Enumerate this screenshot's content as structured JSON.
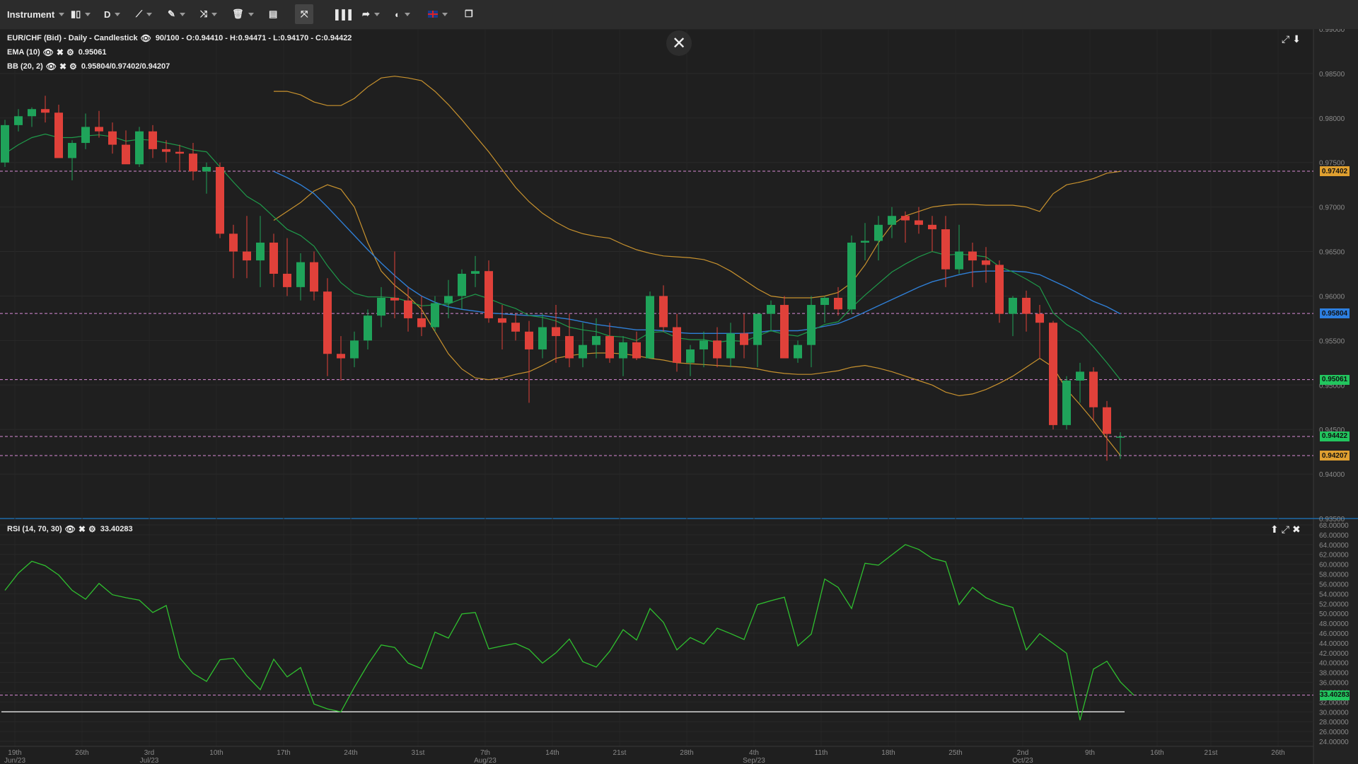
{
  "toolbar": {
    "instrument_label": "Instrument",
    "timeframe_label": "D",
    "icons": [
      "candlestick-icon",
      "line-draw-icon",
      "pencil-icon",
      "trend-icon",
      "trash-icon",
      "layout-icon",
      "fit-icon",
      "volume-icon",
      "share-icon",
      "theme-icon",
      "flag-uk-icon",
      "window-icon"
    ]
  },
  "main_panel": {
    "title": "EUR/CHF (Bid) - Daily - Candlestick",
    "ohlc": "90/100 - O:0.94410 - H:0.94471 - L:0.94170 - C:0.94422",
    "ema_label": "EMA (10)",
    "ema_value": "0.95061",
    "bb_label": "BB (20, 2)",
    "bb_value": "0.95804/0.97402/0.94207"
  },
  "rsi_panel": {
    "label": "RSI (14, 70, 30)",
    "value": "33.40283"
  },
  "price_axis": [
    "0.99000",
    "0.98500",
    "0.98000",
    "0.97500",
    "0.97000",
    "0.96500",
    "0.96000",
    "0.95500",
    "0.95000",
    "0.94500",
    "0.94000",
    "0.93500"
  ],
  "price_tags": [
    {
      "text": "0.97402",
      "price": 0.97402,
      "color": "#e0a030"
    },
    {
      "text": "0.95804",
      "price": 0.95804,
      "color": "#2d7fe0"
    },
    {
      "text": "0.95061",
      "price": 0.95061,
      "color": "#22c55e"
    },
    {
      "text": "0.94422",
      "price": 0.94422,
      "color": "#22c55e"
    },
    {
      "text": "0.94207",
      "price": 0.94207,
      "color": "#e0a030"
    }
  ],
  "rsi_axis": [
    "68.00000",
    "66.00000",
    "64.00000",
    "62.00000",
    "60.00000",
    "58.00000",
    "56.00000",
    "54.00000",
    "52.00000",
    "50.00000",
    "48.00000",
    "46.00000",
    "44.00000",
    "42.00000",
    "40.00000",
    "38.00000",
    "36.00000",
    "34.00000",
    "32.00000",
    "30.00000",
    "28.00000",
    "26.00000",
    "24.00000"
  ],
  "rsi_tag": {
    "text": "33.40283",
    "value": 33.40283,
    "color": "#22c55e"
  },
  "date_axis": [
    {
      "label": "19th",
      "sub": "Jun/23"
    },
    {
      "label": "26th",
      "sub": ""
    },
    {
      "label": "3rd",
      "sub": "Jul/23"
    },
    {
      "label": "10th",
      "sub": ""
    },
    {
      "label": "17th",
      "sub": ""
    },
    {
      "label": "24th",
      "sub": ""
    },
    {
      "label": "31st",
      "sub": ""
    },
    {
      "label": "7th",
      "sub": "Aug/23"
    },
    {
      "label": "14th",
      "sub": ""
    },
    {
      "label": "21st",
      "sub": ""
    },
    {
      "label": "28th",
      "sub": ""
    },
    {
      "label": "4th",
      "sub": "Sep/23"
    },
    {
      "label": "11th",
      "sub": ""
    },
    {
      "label": "18th",
      "sub": ""
    },
    {
      "label": "25th",
      "sub": ""
    },
    {
      "label": "2nd",
      "sub": "Oct/23"
    },
    {
      "label": "9th",
      "sub": ""
    },
    {
      "label": "16th",
      "sub": ""
    },
    {
      "label": "21st",
      "sub": ""
    },
    {
      "label": "26th",
      "sub": ""
    }
  ],
  "chart_data": {
    "type": "candlestick",
    "ohlc": [
      [
        0.975,
        0.9798,
        0.9745,
        0.9792
      ],
      [
        0.9792,
        0.981,
        0.9785,
        0.9802
      ],
      [
        0.9802,
        0.9812,
        0.979,
        0.981
      ],
      [
        0.981,
        0.9825,
        0.9795,
        0.9806
      ],
      [
        0.9806,
        0.9815,
        0.978,
        0.9755
      ],
      [
        0.9755,
        0.9775,
        0.973,
        0.9772
      ],
      [
        0.9772,
        0.9805,
        0.9765,
        0.979
      ],
      [
        0.979,
        0.9808,
        0.9778,
        0.9785
      ],
      [
        0.9785,
        0.9795,
        0.976,
        0.977
      ],
      [
        0.977,
        0.9786,
        0.975,
        0.9748
      ],
      [
        0.9748,
        0.979,
        0.9745,
        0.9785
      ],
      [
        0.9785,
        0.9792,
        0.9755,
        0.9765
      ],
      [
        0.9765,
        0.9775,
        0.975,
        0.9762
      ],
      [
        0.9762,
        0.977,
        0.974,
        0.976
      ],
      [
        0.976,
        0.9772,
        0.973,
        0.974
      ],
      [
        0.974,
        0.975,
        0.9715,
        0.9745
      ],
      [
        0.9745,
        0.975,
        0.9665,
        0.967
      ],
      [
        0.967,
        0.968,
        0.962,
        0.965
      ],
      [
        0.965,
        0.969,
        0.962,
        0.964
      ],
      [
        0.964,
        0.969,
        0.961,
        0.966
      ],
      [
        0.966,
        0.967,
        0.961,
        0.9625
      ],
      [
        0.9625,
        0.9665,
        0.96,
        0.961
      ],
      [
        0.961,
        0.9648,
        0.9595,
        0.9638
      ],
      [
        0.9638,
        0.965,
        0.9595,
        0.9605
      ],
      [
        0.9605,
        0.962,
        0.951,
        0.9535
      ],
      [
        0.9535,
        0.9555,
        0.9505,
        0.953
      ],
      [
        0.953,
        0.956,
        0.952,
        0.955
      ],
      [
        0.955,
        0.9585,
        0.954,
        0.9578
      ],
      [
        0.9578,
        0.961,
        0.9565,
        0.9598
      ],
      [
        0.9598,
        0.965,
        0.9575,
        0.9595
      ],
      [
        0.9595,
        0.961,
        0.956,
        0.9575
      ],
      [
        0.9575,
        0.96,
        0.9555,
        0.9565
      ],
      [
        0.9565,
        0.96,
        0.956,
        0.9592
      ],
      [
        0.9592,
        0.9618,
        0.9575,
        0.96
      ],
      [
        0.96,
        0.963,
        0.9585,
        0.9625
      ],
      [
        0.9625,
        0.9645,
        0.961,
        0.9628
      ],
      [
        0.9628,
        0.964,
        0.957,
        0.9575
      ],
      [
        0.9575,
        0.959,
        0.954,
        0.957
      ],
      [
        0.957,
        0.958,
        0.955,
        0.956
      ],
      [
        0.956,
        0.9572,
        0.948,
        0.954
      ],
      [
        0.954,
        0.958,
        0.953,
        0.9565
      ],
      [
        0.9565,
        0.959,
        0.9525,
        0.9555
      ],
      [
        0.9555,
        0.958,
        0.952,
        0.953
      ],
      [
        0.953,
        0.957,
        0.952,
        0.9545
      ],
      [
        0.9545,
        0.9575,
        0.953,
        0.9555
      ],
      [
        0.9555,
        0.957,
        0.9525,
        0.953
      ],
      [
        0.953,
        0.9555,
        0.951,
        0.9548
      ],
      [
        0.9548,
        0.956,
        0.9528,
        0.953
      ],
      [
        0.953,
        0.9605,
        0.953,
        0.96
      ],
      [
        0.96,
        0.9612,
        0.956,
        0.9565
      ],
      [
        0.9565,
        0.958,
        0.9515,
        0.9525
      ],
      [
        0.9525,
        0.9545,
        0.951,
        0.954
      ],
      [
        0.954,
        0.956,
        0.952,
        0.955
      ],
      [
        0.955,
        0.9565,
        0.952,
        0.953
      ],
      [
        0.953,
        0.957,
        0.952,
        0.9558
      ],
      [
        0.9558,
        0.958,
        0.953,
        0.9545
      ],
      [
        0.9545,
        0.957,
        0.952,
        0.958
      ],
      [
        0.958,
        0.9595,
        0.956,
        0.959
      ],
      [
        0.959,
        0.96,
        0.953,
        0.953
      ],
      [
        0.953,
        0.955,
        0.9525,
        0.9545
      ],
      [
        0.9545,
        0.96,
        0.952,
        0.959
      ],
      [
        0.959,
        0.96,
        0.957,
        0.9598
      ],
      [
        0.9598,
        0.961,
        0.9578,
        0.9585
      ],
      [
        0.9585,
        0.9668,
        0.958,
        0.966
      ],
      [
        0.966,
        0.9682,
        0.964,
        0.9662
      ],
      [
        0.9662,
        0.969,
        0.964,
        0.968
      ],
      [
        0.968,
        0.97,
        0.9665,
        0.969
      ],
      [
        0.969,
        0.9695,
        0.966,
        0.9685
      ],
      [
        0.9685,
        0.97,
        0.967,
        0.968
      ],
      [
        0.968,
        0.969,
        0.965,
        0.9675
      ],
      [
        0.9675,
        0.969,
        0.961,
        0.963
      ],
      [
        0.963,
        0.968,
        0.9625,
        0.965
      ],
      [
        0.965,
        0.966,
        0.961,
        0.964
      ],
      [
        0.964,
        0.9655,
        0.9615,
        0.9635
      ],
      [
        0.9635,
        0.964,
        0.957,
        0.958
      ],
      [
        0.958,
        0.96,
        0.9555,
        0.9598
      ],
      [
        0.9598,
        0.9606,
        0.956,
        0.958
      ],
      [
        0.958,
        0.959,
        0.953,
        0.957
      ],
      [
        0.957,
        0.9572,
        0.945,
        0.9455
      ],
      [
        0.9455,
        0.951,
        0.945,
        0.9505
      ],
      [
        0.9505,
        0.9525,
        0.948,
        0.9515
      ],
      [
        0.9515,
        0.952,
        0.946,
        0.9475
      ],
      [
        0.9475,
        0.9482,
        0.9415,
        0.9445
      ],
      [
        0.9441,
        0.9447,
        0.9417,
        0.9442
      ]
    ],
    "ema10": [
      0.976,
      0.977,
      0.9778,
      0.9782,
      0.9778,
      0.9778,
      0.978,
      0.9781,
      0.9779,
      0.9774,
      0.9776,
      0.9775,
      0.9772,
      0.9769,
      0.9764,
      0.9762,
      0.9745,
      0.9728,
      0.9712,
      0.9703,
      0.9689,
      0.9675,
      0.9668,
      0.9656,
      0.9634,
      0.9615,
      0.9603,
      0.9599,
      0.9599,
      0.9598,
      0.9594,
      0.9589,
      0.959,
      0.9591,
      0.9597,
      0.9602,
      0.9597,
      0.9591,
      0.9586,
      0.9578,
      0.9576,
      0.9572,
      0.9565,
      0.9562,
      0.956,
      0.9555,
      0.9554,
      0.955,
      0.9559,
      0.956,
      0.9553,
      0.9551,
      0.9551,
      0.9548,
      0.955,
      0.9549,
      0.9555,
      0.9561,
      0.9557,
      0.9555,
      0.9561,
      0.9568,
      0.9571,
      0.9587,
      0.9601,
      0.9614,
      0.9627,
      0.9636,
      0.9644,
      0.965,
      0.9646,
      0.9647,
      0.9646,
      0.9644,
      0.9633,
      0.9627,
      0.9619,
      0.961,
      0.9581,
      0.9568,
      0.9559,
      0.9543,
      0.9525,
      0.9506
    ],
    "sma20": [
      null,
      null,
      null,
      null,
      null,
      null,
      null,
      null,
      null,
      null,
      null,
      null,
      null,
      null,
      null,
      null,
      null,
      null,
      null,
      null,
      0.974,
      0.9733,
      0.9725,
      0.9715,
      0.97,
      0.9684,
      0.9668,
      0.9652,
      0.9637,
      0.9623,
      0.961,
      0.96,
      0.9593,
      0.9588,
      0.9585,
      0.9583,
      0.9581,
      0.958,
      0.9579,
      0.9578,
      0.9578,
      0.9576,
      0.9574,
      0.9571,
      0.9568,
      0.9566,
      0.9564,
      0.9562,
      0.9562,
      0.9561,
      0.9559,
      0.9558,
      0.9558,
      0.9558,
      0.9558,
      0.9558,
      0.9559,
      0.9561,
      0.9561,
      0.9561,
      0.9563,
      0.9566,
      0.9569,
      0.9575,
      0.9582,
      0.9589,
      0.9596,
      0.9603,
      0.961,
      0.9616,
      0.962,
      0.9624,
      0.9627,
      0.9628,
      0.9628,
      0.9628,
      0.9627,
      0.9624,
      0.9617,
      0.961,
      0.9602,
      0.9594,
      0.9588,
      0.958
    ],
    "bb_upper": [
      null,
      null,
      null,
      null,
      null,
      null,
      null,
      null,
      null,
      null,
      null,
      null,
      null,
      null,
      null,
      null,
      null,
      null,
      null,
      null,
      0.983,
      0.983,
      0.9826,
      0.9818,
      0.9814,
      0.9814,
      0.9822,
      0.9835,
      0.9845,
      0.9847,
      0.9845,
      0.9842,
      0.983,
      0.9815,
      0.9798,
      0.978,
      0.9762,
      0.9742,
      0.9722,
      0.9706,
      0.9693,
      0.9683,
      0.9675,
      0.967,
      0.9667,
      0.9665,
      0.9658,
      0.9652,
      0.9648,
      0.9645,
      0.9644,
      0.9643,
      0.9641,
      0.9636,
      0.9628,
      0.9618,
      0.9608,
      0.96,
      0.9598,
      0.9598,
      0.9598,
      0.96,
      0.9604,
      0.9615,
      0.9635,
      0.966,
      0.968,
      0.969,
      0.9695,
      0.97,
      0.9702,
      0.9703,
      0.9703,
      0.9702,
      0.9702,
      0.9702,
      0.97,
      0.9695,
      0.9715,
      0.9725,
      0.9728,
      0.9732,
      0.9738,
      0.974
    ],
    "bb_lower": [
      null,
      null,
      null,
      null,
      null,
      null,
      null,
      null,
      null,
      null,
      null,
      null,
      null,
      null,
      null,
      null,
      null,
      null,
      null,
      null,
      0.9685,
      0.9695,
      0.9705,
      0.9718,
      0.9725,
      0.972,
      0.97,
      0.966,
      0.9628,
      0.9612,
      0.96,
      0.9585,
      0.956,
      0.9535,
      0.9518,
      0.9508,
      0.9506,
      0.9508,
      0.9512,
      0.9515,
      0.9522,
      0.953,
      0.9533,
      0.9535,
      0.9536,
      0.9536,
      0.9535,
      0.9533,
      0.953,
      0.9528,
      0.9525,
      0.9524,
      0.9523,
      0.9522,
      0.9521,
      0.952,
      0.9518,
      0.9515,
      0.9513,
      0.9512,
      0.9512,
      0.9514,
      0.9516,
      0.952,
      0.9522,
      0.9519,
      0.9515,
      0.951,
      0.9505,
      0.95,
      0.9492,
      0.9488,
      0.949,
      0.9495,
      0.9502,
      0.951,
      0.952,
      0.953,
      0.952,
      0.9495,
      0.9478,
      0.946,
      0.944,
      0.9421
    ],
    "rsi": [
      54.7,
      58.2,
      60.6,
      59.7,
      57.8,
      54.7,
      52.9,
      56.1,
      53.8,
      53.2,
      52.7,
      50.2,
      51.6,
      41.0,
      37.8,
      36.2,
      40.6,
      40.9,
      37.3,
      34.5,
      40.7,
      37.1,
      39.0,
      31.6,
      30.6,
      30.0,
      35.0,
      39.6,
      43.6,
      43.1,
      39.9,
      38.8,
      46.2,
      45.0,
      49.9,
      50.2,
      42.8,
      43.4,
      43.9,
      42.7,
      39.9,
      42.0,
      44.8,
      40.2,
      39.1,
      42.3,
      46.7,
      44.6,
      51.0,
      48.2,
      42.6,
      45.1,
      43.8,
      47.0,
      45.9,
      44.7,
      51.8,
      52.6,
      53.3,
      43.4,
      45.8,
      57.0,
      55.3,
      51.0,
      60.2,
      59.8,
      61.9,
      64.0,
      63.0,
      61.2,
      60.5,
      51.8,
      55.3,
      53.2,
      52.0,
      51.2,
      42.6,
      45.9,
      43.9,
      41.9,
      28.3,
      38.7,
      40.3,
      36.1,
      33.4
    ],
    "ylim_price": [
      0.935,
      0.99
    ],
    "ylim_rsi": [
      23.0,
      69.0
    ],
    "rsi_bands": [
      30,
      70
    ],
    "horizontal_levels": [
      0.97402,
      0.95804,
      0.95061,
      0.94422,
      0.94207
    ],
    "rsi_level": 33.40283
  }
}
